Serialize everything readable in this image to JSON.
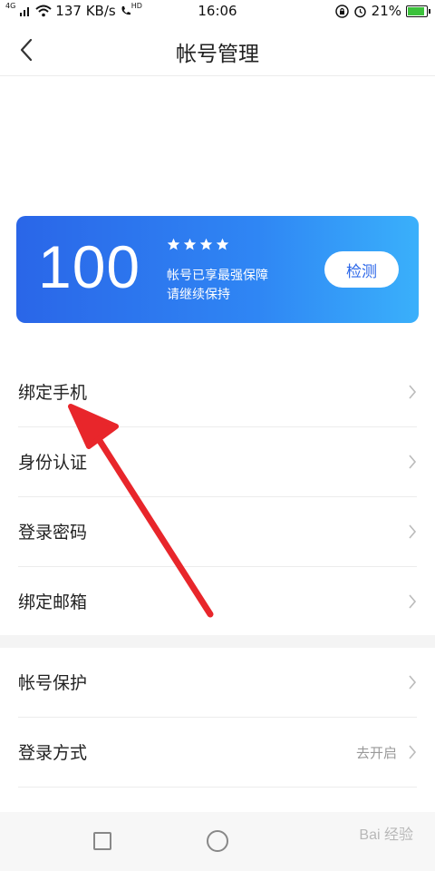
{
  "status_bar": {
    "network_type": "4G",
    "speed": "137 KB/s",
    "call_badge": "HD",
    "time": "16:06",
    "battery": "21%"
  },
  "header": {
    "title": "帐号管理"
  },
  "score_card": {
    "score": "100",
    "stars": 4,
    "line1": "帐号已享最强保障",
    "line2": "请继续保持",
    "check_label": "检测"
  },
  "sections": [
    {
      "items": [
        {
          "label": "绑定手机"
        },
        {
          "label": "身份认证"
        },
        {
          "label": "登录密码"
        },
        {
          "label": "绑定邮箱"
        }
      ]
    },
    {
      "items": [
        {
          "label": "帐号保护"
        },
        {
          "label": "登录方式",
          "value": "去开启"
        }
      ]
    }
  ],
  "watermark": "Bai 经验",
  "colors": {
    "card_gradient_start": "#2a66e8",
    "card_gradient_end": "#3ab0fb",
    "arrow": "#e8262b",
    "divider": "#ececec"
  },
  "icons": [
    "back-arrow-icon",
    "star-icon",
    "chevron-right-icon",
    "wifi-icon",
    "signal-icon",
    "alarm-icon",
    "lock-icon",
    "battery-icon"
  ]
}
